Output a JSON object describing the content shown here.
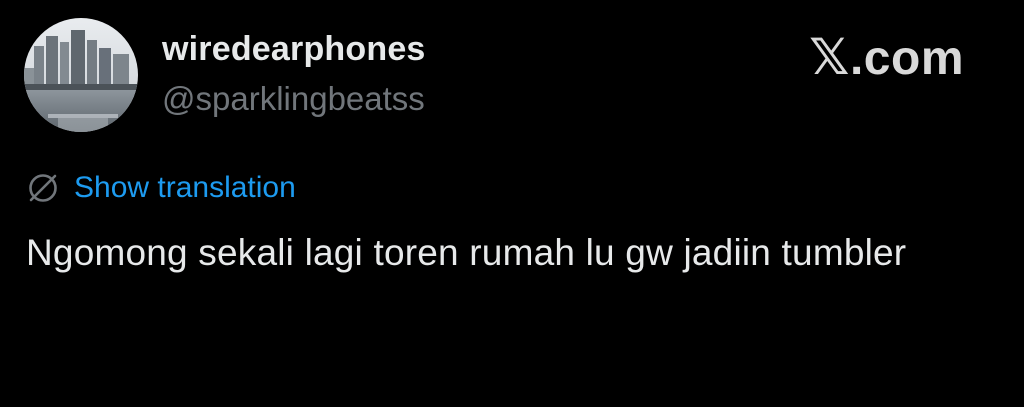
{
  "author": {
    "display_name": "wiredearphones",
    "handle": "@sparklingbeatss",
    "avatar_icon": "city-skyline-avatar"
  },
  "brand": {
    "x_letter": "𝕏",
    "domain": ".com"
  },
  "translation": {
    "icon": "globe-icon",
    "label": "Show translation",
    "link_color": "#1d9bf0"
  },
  "tweet": {
    "text": "Ngomong sekali lagi toren rumah lu gw jadiin tumbler"
  },
  "colors": {
    "background": "#000000",
    "primary_text": "#e7e9ea",
    "secondary_text": "#71767b"
  }
}
